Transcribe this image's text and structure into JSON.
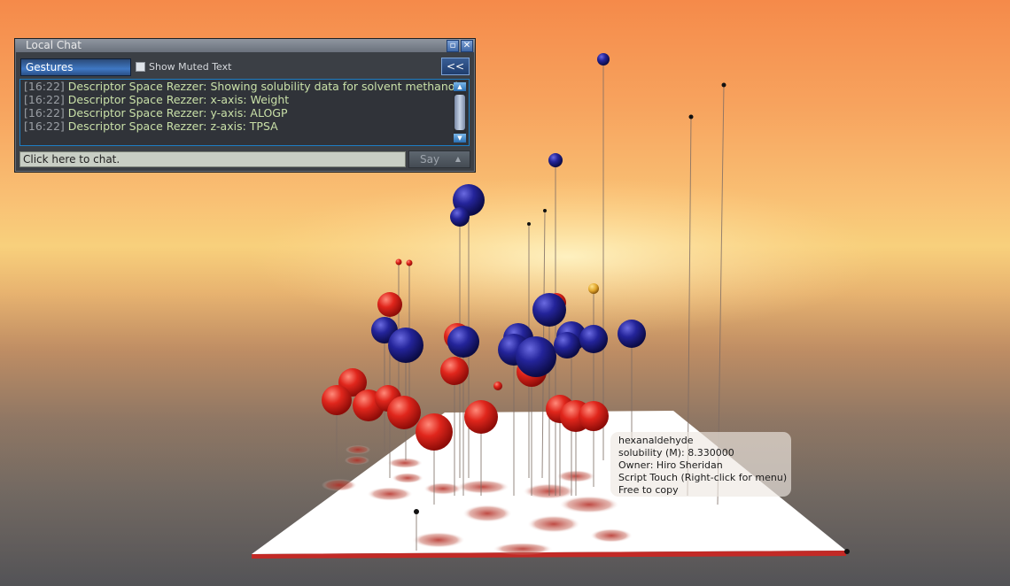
{
  "chat": {
    "title": "Local Chat",
    "gestures_label": "Gestures",
    "show_muted_label": "Show Muted Text",
    "collapse_label": "<<",
    "history": [
      {
        "time": "[16:22]",
        "text": "Descriptor Space Rezzer: Showing solubility data for solvent methanol"
      },
      {
        "time": "[16:22]",
        "text": "Descriptor Space Rezzer: x-axis: Weight"
      },
      {
        "time": "[16:22]",
        "text": "Descriptor Space Rezzer: y-axis: ALOGP"
      },
      {
        "time": "[16:22]",
        "text": "Descriptor Space Rezzer: z-axis: TPSA"
      }
    ],
    "input_placeholder": "Click here to chat.",
    "say_label": "Say"
  },
  "tooltip": {
    "name": "hexanaldehyde",
    "solubility": "solubility (M): 8.330000",
    "owner": "Owner: Hiro Sheridan",
    "touch": "Script Touch (Right-click for menu)",
    "copy": "Free to copy"
  },
  "colors": {
    "sky": "#f7a35e",
    "low_solubility_sphere": "#d2201a",
    "high_solubility_sphere": "#1c1c80",
    "selected_sphere": "#e0a52a",
    "platform": "#ffffff",
    "chat_accent": "#1e7ec4"
  }
}
